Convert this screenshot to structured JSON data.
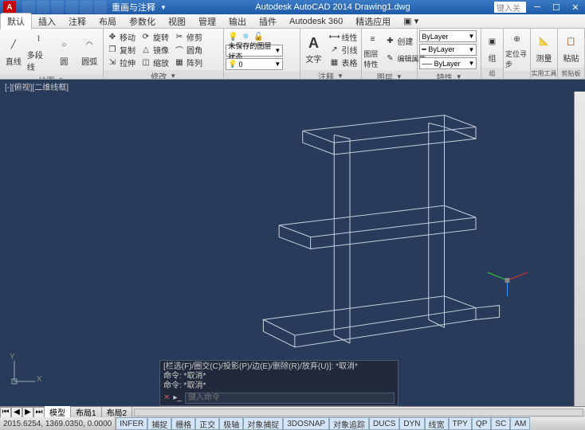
{
  "titlebar": {
    "app_title": "Autodesk AutoCAD 2014    Drawing1.dwg",
    "logo_text": "A",
    "workspace": "重画与注释",
    "search_placeholder": "键入关"
  },
  "menubar": {
    "tabs": [
      "默认",
      "插入",
      "注释",
      "布局",
      "参数化",
      "视图",
      "管理",
      "输出",
      "插件",
      "Autodesk 360",
      "精选应用"
    ]
  },
  "ribbon": {
    "draw": {
      "label": "绘图",
      "line": "直线",
      "polyline": "多段线",
      "circle": "圆",
      "arc": "圆弧"
    },
    "modify": {
      "label": "修改",
      "move": "移动",
      "rotate": "旋转",
      "trim": "修剪",
      "copy": "复制",
      "mirror": "镜像",
      "fillet": "圆角",
      "stretch": "拉伸",
      "scale": "缩放",
      "array": "阵列",
      "unsaved": "未保存的图层状态"
    },
    "annotation": {
      "label": "注释",
      "text": "文字",
      "linear": "线性",
      "leader": "引线",
      "table": "表格"
    },
    "layer": {
      "label": "图层",
      "props": "图层特性",
      "create": "创建",
      "editattr": "编辑属性"
    },
    "properties": {
      "label": "特性",
      "bylayer": "ByLayer"
    },
    "group": {
      "label": "组",
      "btn": "组"
    },
    "measure": {
      "label": "实用工具",
      "btn": "测量"
    },
    "locate": {
      "btn": "定位寻步"
    },
    "clipboard": {
      "label": "剪贴板",
      "paste": "粘贴"
    }
  },
  "filetab": {
    "label": "[-][俯视][二维线框]"
  },
  "layout_tabs": {
    "model": "模型",
    "l1": "布局1",
    "l2": "布局2"
  },
  "command": {
    "hist1": "[栏选(F)/圈交(C)/投影(P)/边(E)/删除(R)/放弃(U)]: *取消*",
    "hist2": "命令: *取消*",
    "hist3": "命令: *取消*",
    "prompt_placeholder": "键入命令"
  },
  "status": {
    "coords": "2015.6254, 1369.0350, 0.0000",
    "btns": [
      "INFER",
      "捕捉",
      "栅格",
      "正交",
      "极轴",
      "对象捕捉",
      "3DOSNAP",
      "对象追踪",
      "DUCS",
      "DYN",
      "线宽",
      "TPY",
      "QP",
      "SC",
      "AM"
    ]
  },
  "ucs": {
    "x": "X",
    "y": "Y"
  }
}
